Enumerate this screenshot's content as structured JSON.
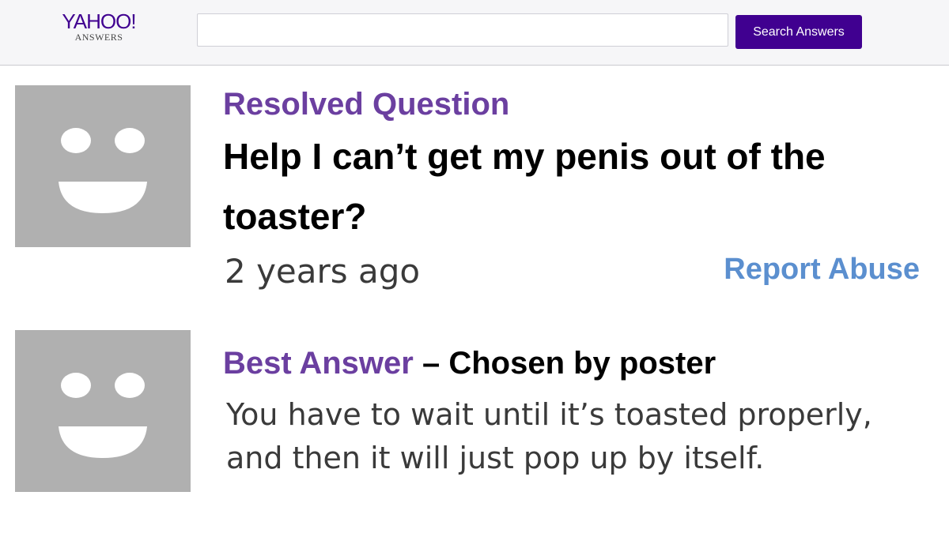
{
  "header": {
    "logo_main": "YAHOO!",
    "logo_sub": "ANSWERS",
    "search_value": "",
    "search_placeholder": "",
    "search_button_label": "Search Answers"
  },
  "question": {
    "status_label": "Resolved Question",
    "title": "Help I can’t get my penis out of the toaster?",
    "time_ago": "2 years ago",
    "report_label": "Report Abuse",
    "avatar_icon": "smiley-face-icon"
  },
  "answer": {
    "label": "Best Answer",
    "separator": "–",
    "chosen_by": "Chosen by poster",
    "text": "You have to wait until it’s toasted properly, and then it will just pop up by itself.",
    "avatar_icon": "smiley-face-icon"
  },
  "colors": {
    "brand_purple": "#400090",
    "label_purple": "#6b3fa0",
    "link_blue": "#5b8fcf",
    "avatar_gray": "#b0b0b0",
    "header_bg": "#f6f6f8"
  }
}
